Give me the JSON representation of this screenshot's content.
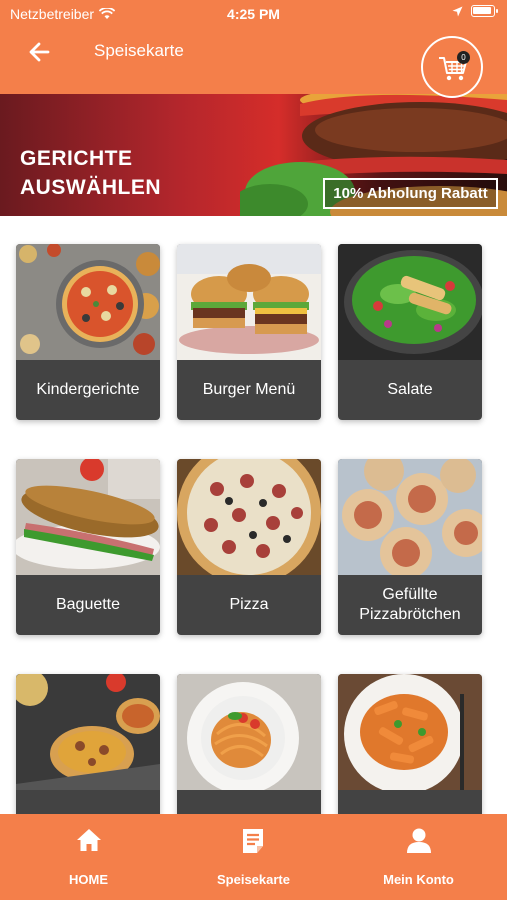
{
  "status_bar": {
    "carrier": "Netzbetreiber",
    "time": "4:25 PM"
  },
  "nav": {
    "title": "Speisekarte",
    "cart_count": "0"
  },
  "banner": {
    "title_line1": "GERICHTE",
    "title_line2": "AUSWÄHLEN",
    "rabatt": "10% Abholung Rabatt"
  },
  "categories": [
    {
      "label": "Kindergerichte"
    },
    {
      "label": "Burger Menü"
    },
    {
      "label": "Salate"
    },
    {
      "label": "Baguette"
    },
    {
      "label": "Pizza"
    },
    {
      "label": "Gefüllte Pizzabrötchen"
    }
  ],
  "bottom_nav": {
    "home": "HOME",
    "menu": "Speisekarte",
    "account": "Mein Konto"
  },
  "colors": {
    "accent": "#f47f4a",
    "card_label_bg": "#434343"
  },
  "icons": [
    "wifi-icon",
    "location-arrow-icon",
    "battery-icon",
    "back-arrow-icon",
    "cart-icon",
    "home-icon",
    "menu-list-icon",
    "user-icon"
  ]
}
